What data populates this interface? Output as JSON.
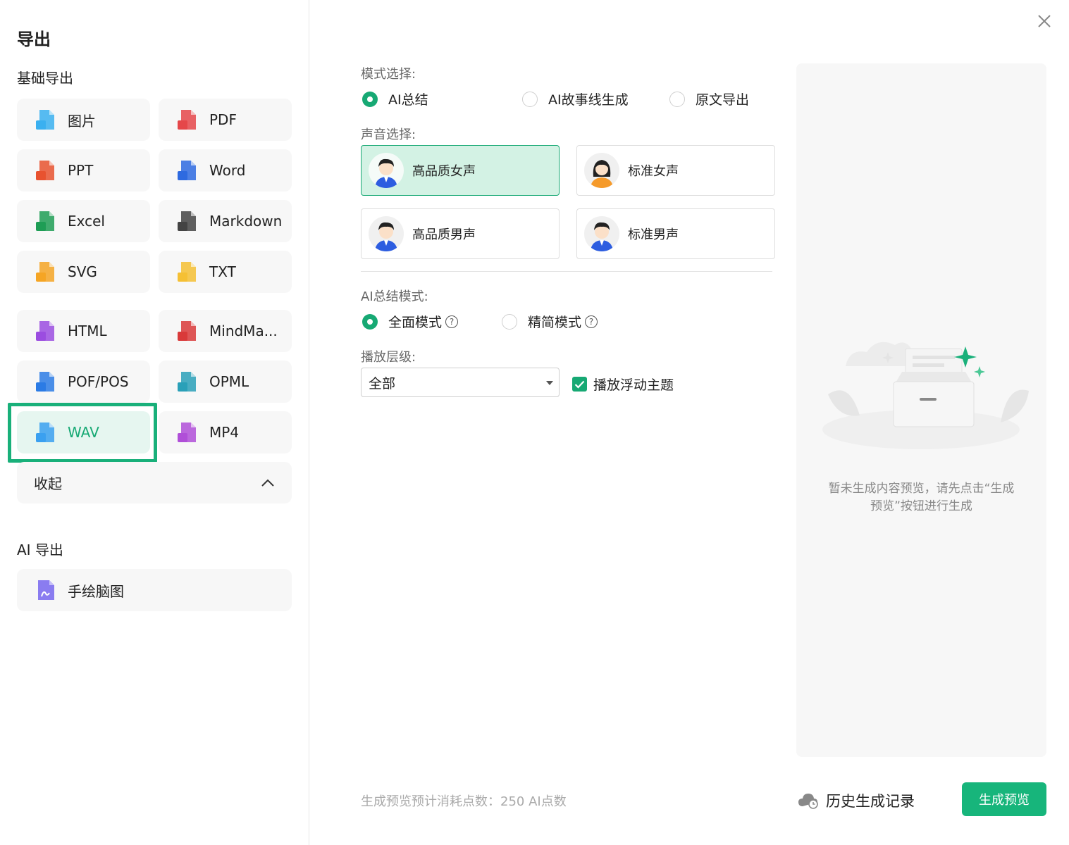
{
  "dialog": {
    "title": "导出",
    "basic_section": "基础导出",
    "ai_section": "AI 导出",
    "formats": [
      {
        "label": "图片",
        "icon": "image-file-icon",
        "color": "#3ab0f0"
      },
      {
        "label": "PDF",
        "icon": "pdf-file-icon",
        "color": "#e5474a"
      },
      {
        "label": "PPT",
        "icon": "ppt-file-icon",
        "color": "#e8522f"
      },
      {
        "label": "Word",
        "icon": "word-file-icon",
        "color": "#2e6ae0"
      },
      {
        "label": "Excel",
        "icon": "excel-file-icon",
        "color": "#1e9d55"
      },
      {
        "label": "Markdown",
        "icon": "markdown-file-icon",
        "color": "#444444"
      },
      {
        "label": "SVG",
        "icon": "svg-file-icon",
        "color": "#f5a524"
      },
      {
        "label": "TXT",
        "icon": "txt-file-icon",
        "color": "#f5c034"
      },
      {
        "label": "HTML",
        "icon": "html-file-icon",
        "color": "#9b4de0"
      },
      {
        "label": "MindMa...",
        "icon": "mindmanager-file-icon",
        "color": "#d93a3a"
      },
      {
        "label": "POF/POS",
        "icon": "pof-file-icon",
        "color": "#2b7be5"
      },
      {
        "label": "OPML",
        "icon": "opml-file-icon",
        "color": "#2aa0b8"
      },
      {
        "label": "WAV",
        "icon": "wav-file-icon",
        "color": "#3aa0f0"
      },
      {
        "label": "MP4",
        "icon": "mp4-file-icon",
        "color": "#b04fd8"
      }
    ],
    "selected_format": "WAV",
    "collapse_label": "收起",
    "ai_formats": [
      {
        "label": "手绘脑图",
        "icon": "hand-drawn-mindmap-icon",
        "color": "#6a5ce0"
      }
    ]
  },
  "options": {
    "mode_label": "模式选择:",
    "modes": [
      {
        "label": "AI总结",
        "checked": true
      },
      {
        "label": "AI故事线生成",
        "checked": false
      },
      {
        "label": "原文导出",
        "checked": false
      }
    ],
    "voice_label": "声音选择:",
    "voices": [
      {
        "label": "高品质女声",
        "selected": true,
        "avatar": "male-avatar-icon"
      },
      {
        "label": "标准女声",
        "selected": false,
        "avatar": "female-avatar-icon"
      },
      {
        "label": "高品质男声",
        "selected": false,
        "avatar": "male-avatar-icon"
      },
      {
        "label": "标准男声",
        "selected": false,
        "avatar": "male-avatar-icon"
      }
    ],
    "summary_mode_label": "AI总结模式:",
    "summary_modes": [
      {
        "label": "全面模式",
        "checked": true
      },
      {
        "label": "精简模式",
        "checked": false
      }
    ],
    "level_label": "播放层级:",
    "level_value": "全部",
    "floating_topic_label": "播放浮动主题",
    "floating_topic_checked": true
  },
  "preview": {
    "empty_line1": "暂未生成内容预览，请先点击“生成",
    "empty_line2": "预览”按钮进行生成"
  },
  "footer": {
    "cost_text": "生成预览预计消耗点数：250 AI点数",
    "history_label": "历史生成记录",
    "generate_label": "生成预览"
  },
  "colors": {
    "accent": "#17a974",
    "selected_bg": "#e6f6f0",
    "voice_selected_bg": "#d3f2e4"
  }
}
